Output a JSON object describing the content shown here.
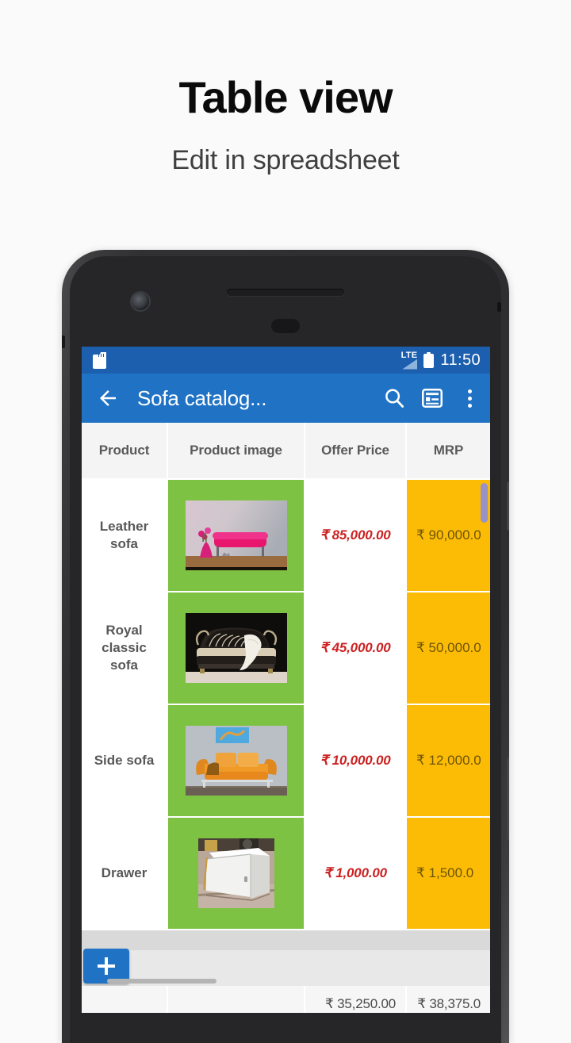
{
  "promo": {
    "title": "Table view",
    "subtitle": "Edit in spreadsheet"
  },
  "device": {
    "icons": {
      "camera": "front-camera",
      "earpiece": "earpiece-speaker",
      "sensor": "proximity-sensor",
      "power": "power-button",
      "volume": "volume-button"
    }
  },
  "statusbar": {
    "sd_icon": "sd-card-icon",
    "network_label": "LTE",
    "signal_icon": "signal-bars-icon",
    "battery_icon": "battery-icon",
    "time": "11:50",
    "background": "#1b5fae"
  },
  "appbar": {
    "back_icon": "back-arrow-icon",
    "title": "Sofa catalog...",
    "search_icon": "search-icon",
    "form_view_icon": "form-view-icon",
    "overflow_icon": "more-vert-icon",
    "background": "#2073c4"
  },
  "table": {
    "columns": [
      "Product",
      "Product image",
      "Offer Price",
      "MRP"
    ],
    "rows": [
      {
        "product": "Leather\nsofa",
        "image_alt": "pink-leather-sofa-photo",
        "offer_price": "₹ 85,000.00",
        "mrp": "₹ 90,000.0"
      },
      {
        "product": "Royal\nclassic\nsofa",
        "image_alt": "royal-classic-sofa-photo",
        "offer_price": "₹ 45,000.00",
        "mrp": "₹ 50,000.0"
      },
      {
        "product": "Side sofa",
        "image_alt": "orange-side-sofa-photo",
        "offer_price": "₹ 10,000.00",
        "mrp": "₹ 12,000.0"
      },
      {
        "product": "Drawer",
        "image_alt": "white-drawer-cabinet-photo",
        "offer_price": "₹ 1,000.00",
        "mrp": "₹ 1,500.0"
      }
    ],
    "totals": {
      "product": "",
      "image": "",
      "offer_price": "₹ 35,250.00",
      "mrp": "₹ 38,375.0"
    },
    "colors": {
      "image_cell": "#7dc242",
      "mrp_cell": "#fcbc06",
      "offer_price_text": "#cc2222",
      "header_cell": "#f4f4f4",
      "scroll_thumb": "#9892c8"
    }
  },
  "bottombar": {
    "add_icon": "add-plus-icon",
    "add_label": "+",
    "h_scrollbar": "horizontal-scrollbar"
  }
}
